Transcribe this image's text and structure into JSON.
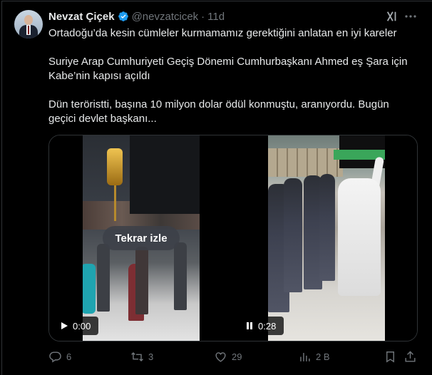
{
  "author": {
    "name": "Nevzat Çiçek",
    "handle": "@nevzatcicek",
    "separator": "·",
    "time": "11d"
  },
  "tweet": {
    "line1": "Ortadoğu’da kesin cümleler kurmamamız gerektiğini anlatan en iyi kareler",
    "line2": "Suriye Arap Cumhuriyeti Geçiş Dönemi Cumhurbaşkanı Ahmed eş  Şara için Kabe’nin kapısı açıldı",
    "line3": "Dün teröristti, başına 10 milyon dolar ödül konmuştu, aranıyordu. Bugün geçici devlet başkanı..."
  },
  "media": {
    "replay_label": "Tekrar izle",
    "video1_time": "0:00",
    "video2_time": "0:28"
  },
  "actions": {
    "replies": "6",
    "reposts": "3",
    "likes": "29",
    "views": "2 B"
  },
  "colors": {
    "verified": "#1d9bf0",
    "muted": "#71767b",
    "text": "#e7e9ea",
    "border": "#2f3336"
  }
}
